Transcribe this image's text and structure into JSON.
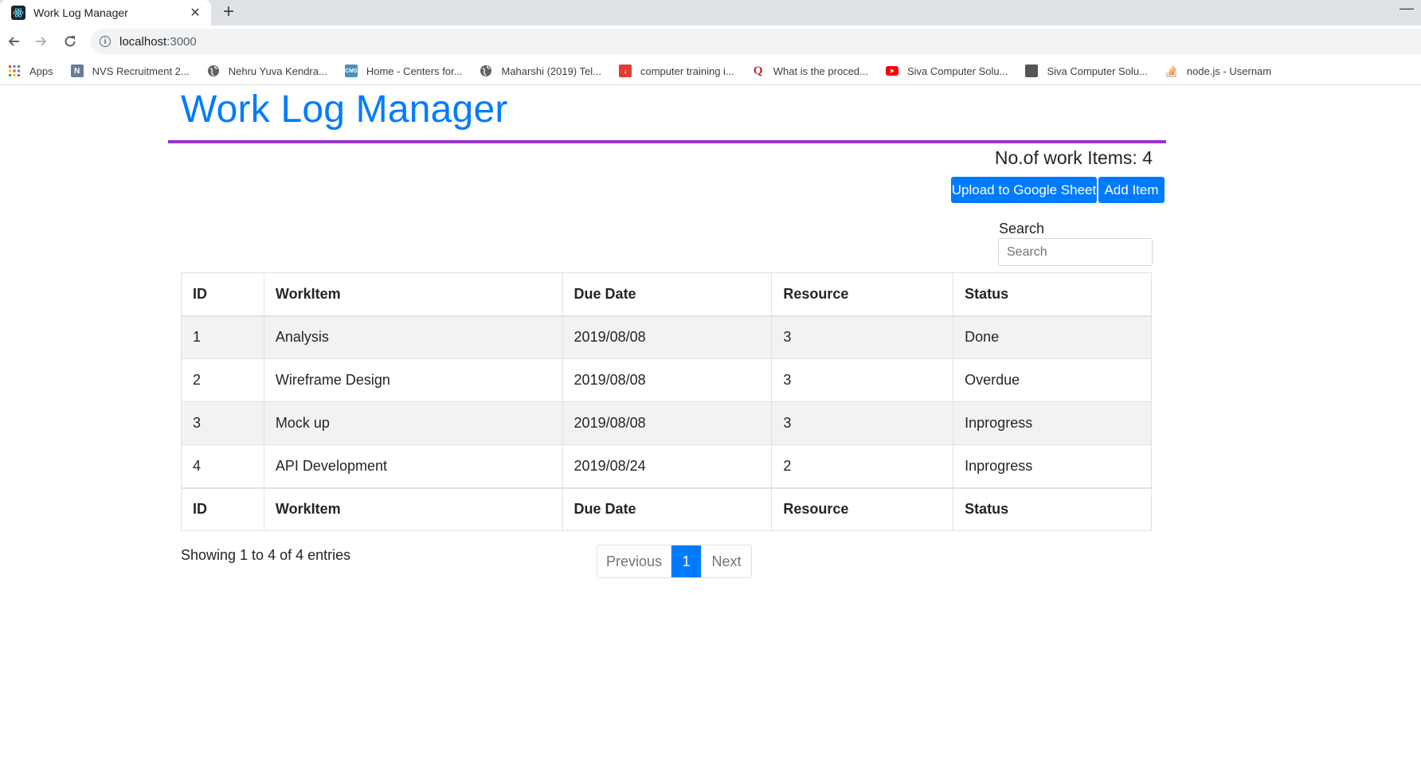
{
  "browser": {
    "tab_title": "Work Log Manager",
    "url_host": "localhost",
    "url_port": ":3000",
    "bookmarks": [
      {
        "label": "Apps",
        "icon": "apps-grid-icon",
        "color": "#ea4335"
      },
      {
        "label": "NVS Recruitment 2...",
        "icon": "nvs-site-icon",
        "color": "#6b7a99"
      },
      {
        "label": "Nehru Yuva Kendra...",
        "icon": "globe-icon",
        "color": "#5f6368"
      },
      {
        "label": "Home - Centers for...",
        "icon": "cms-site-icon",
        "color": "#4a90c2"
      },
      {
        "label": "Maharshi (2019) Tel...",
        "icon": "globe-icon",
        "color": "#5f6368"
      },
      {
        "label": "computer training i...",
        "icon": "bookmark-red-icon",
        "color": "#e53935"
      },
      {
        "label": "What is the proced...",
        "icon": "quora-icon",
        "color": "#b92b27"
      },
      {
        "label": "Siva Computer Solu...",
        "icon": "youtube-icon",
        "color": "#ff0000"
      },
      {
        "label": "Siva Computer Solu...",
        "icon": "site-thumbnail-icon",
        "color": "#555555"
      },
      {
        "label": "node.js - Usernam",
        "icon": "stackoverflow-icon",
        "color": "#f48024"
      }
    ]
  },
  "page": {
    "title": "Work Log Manager",
    "count_label": "No.of work Items: 4",
    "buttons": {
      "upload": "Upload to Google Sheet",
      "add": "Add Item"
    },
    "search": {
      "label": "Search",
      "placeholder": "Search",
      "value": ""
    },
    "table": {
      "columns": [
        "ID",
        "WorkItem",
        "Due Date",
        "Resource",
        "Status"
      ],
      "rows": [
        [
          "1",
          "Analysis",
          "2019/08/08",
          "3",
          "Done"
        ],
        [
          "2",
          "Wireframe Design",
          "2019/08/08",
          "3",
          "Overdue"
        ],
        [
          "3",
          "Mock up",
          "2019/08/08",
          "3",
          "Inprogress"
        ],
        [
          "4",
          "API Development",
          "2019/08/24",
          "2",
          "Inprogress"
        ]
      ]
    },
    "showing": "Showing 1 to 4 of 4 entries",
    "pagination": {
      "previous": "Previous",
      "current": "1",
      "next": "Next"
    }
  },
  "colors": {
    "primary": "#007bff",
    "rule": "#9932cc",
    "striped_row": "#f2f2f2"
  }
}
